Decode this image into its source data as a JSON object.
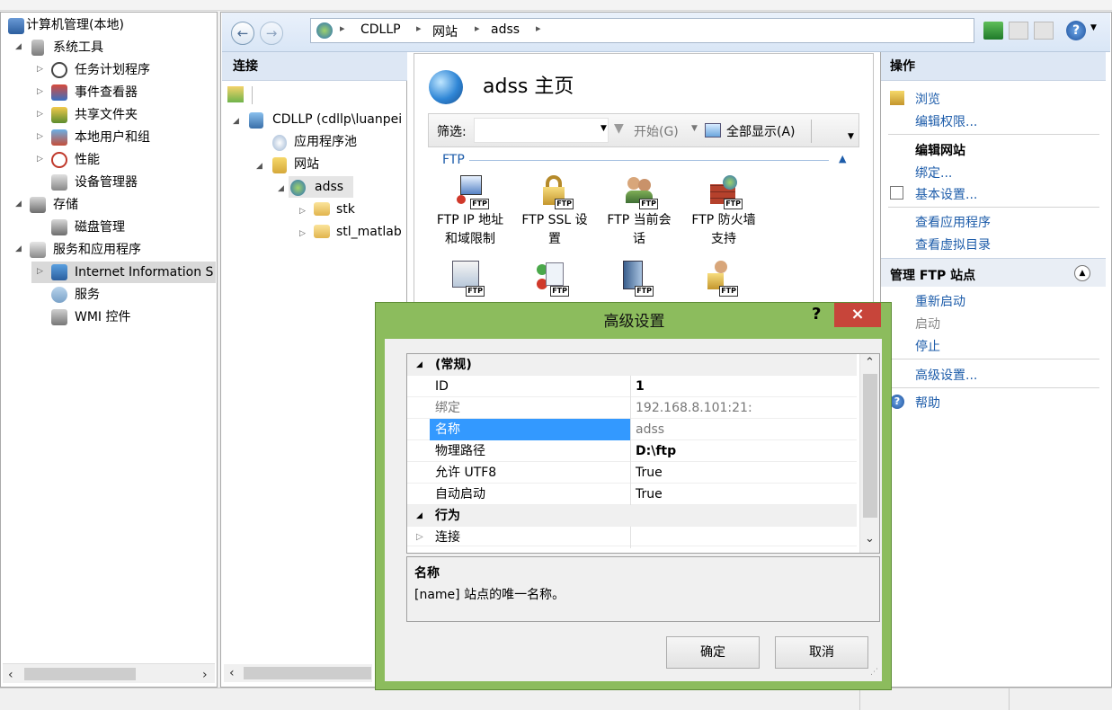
{
  "tree": {
    "items": [
      {
        "label": "计算机管理(本地)",
        "expander": ""
      },
      {
        "label": "系统工具",
        "expander": "◢"
      },
      {
        "label": "任务计划程序",
        "expander": "▷"
      },
      {
        "label": "事件查看器",
        "expander": "▷"
      },
      {
        "label": "共享文件夹",
        "expander": "▷"
      },
      {
        "label": "本地用户和组",
        "expander": "▷"
      },
      {
        "label": "性能",
        "expander": "▷"
      },
      {
        "label": "设备管理器",
        "expander": ""
      },
      {
        "label": "存储",
        "expander": "◢"
      },
      {
        "label": "磁盘管理",
        "expander": ""
      },
      {
        "label": "服务和应用程序",
        "expander": "◢"
      },
      {
        "label": "Internet Information S",
        "expander": "▷"
      },
      {
        "label": "服务",
        "expander": ""
      },
      {
        "label": "WMI 控件",
        "expander": ""
      }
    ]
  },
  "address": {
    "crumbs": [
      "CDLLP",
      "网站",
      "adss"
    ]
  },
  "connections": {
    "title": "连接",
    "items": [
      {
        "label": "CDLLP (cdllp\\luanpei",
        "expander": "◢"
      },
      {
        "label": "应用程序池",
        "expander": ""
      },
      {
        "label": "网站",
        "expander": "◢"
      },
      {
        "label": "adss",
        "expander": "◢"
      },
      {
        "label": "stk",
        "expander": "▷"
      },
      {
        "label": "stl_matlab",
        "expander": "▷"
      }
    ]
  },
  "content": {
    "title": "adss 主页",
    "filter_label": "筛选:",
    "start_label": "开始(G)",
    "show_all_label": "全部显示(A)",
    "group_label": "FTP",
    "features": [
      {
        "line1": "FTP IP 地址",
        "line2": "和域限制"
      },
      {
        "line1": "FTP SSL 设",
        "line2": "置"
      },
      {
        "line1": "FTP 当前会",
        "line2": "话"
      },
      {
        "line1": "FTP 防火墙",
        "line2": "支持"
      }
    ]
  },
  "actions": {
    "title": "操作",
    "items": [
      {
        "label": "浏览",
        "style": "link"
      },
      {
        "label": "编辑权限...",
        "style": "link"
      },
      {
        "label": "编辑网站",
        "style": "bold"
      },
      {
        "label": "绑定...",
        "style": "link"
      },
      {
        "label": "基本设置...",
        "style": "link"
      },
      {
        "label": "查看应用程序",
        "style": "link"
      },
      {
        "label": "查看虚拟目录",
        "style": "link"
      }
    ],
    "ftp_title": "管理 FTP 站点",
    "ftp_items": [
      {
        "label": "重新启动",
        "style": "link"
      },
      {
        "label": "启动",
        "style": "gray"
      },
      {
        "label": "停止",
        "style": "link"
      },
      {
        "label": "高级设置...",
        "style": "link"
      },
      {
        "label": "帮助",
        "style": "link"
      }
    ]
  },
  "dialog": {
    "title": "高级设置",
    "help": "?",
    "close": "×",
    "rows": [
      {
        "key": "(常规)",
        "value": "",
        "category": true,
        "marker": "◢"
      },
      {
        "key": "ID",
        "value": "1",
        "bold": true
      },
      {
        "key": "绑定",
        "value": "192.168.8.101:21:",
        "gray": true
      },
      {
        "key": "名称",
        "value": "adss",
        "selected": true
      },
      {
        "key": "物理路径",
        "value": "D:\\ftp",
        "bold": true
      },
      {
        "key": "允许 UTF8",
        "value": "True"
      },
      {
        "key": "自动启动",
        "value": "True"
      },
      {
        "key": "行为",
        "value": "",
        "category": true,
        "marker": "◢"
      },
      {
        "key": "连接",
        "value": "",
        "marker": "▷"
      }
    ],
    "desc_title": "名称",
    "desc_text": "[name] 站点的唯一名称。",
    "ok_label": "确定",
    "cancel_label": "取消"
  },
  "colors": {
    "dialog_frame": "#8cbc5d",
    "link": "#1d5caa",
    "selection": "#3399ff",
    "close_button": "#c7453a"
  }
}
